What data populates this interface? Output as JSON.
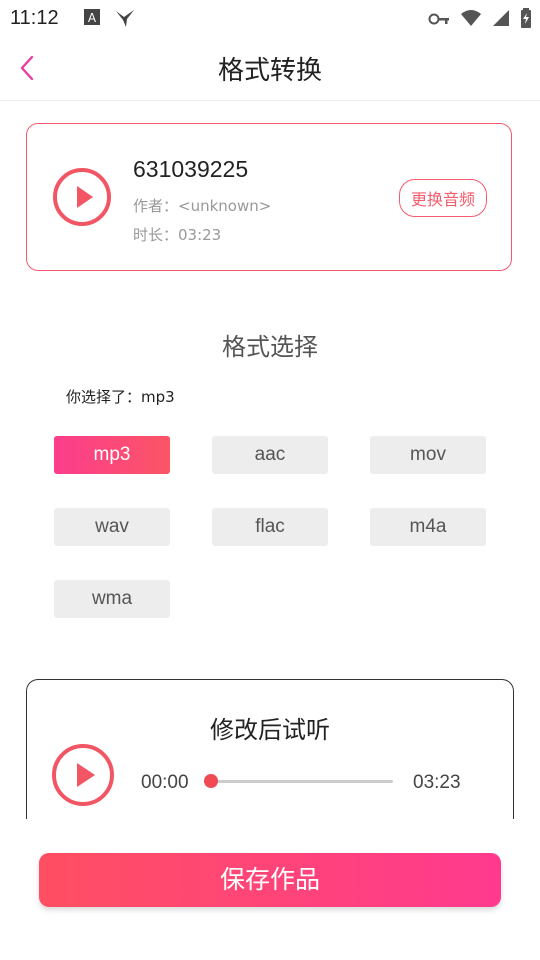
{
  "status_bar": {
    "time": "11:12"
  },
  "header": {
    "title": "格式转换"
  },
  "source_audio": {
    "title": "631039225",
    "author": "作者：<unknown>",
    "duration": "时长：03:23",
    "change_label": "更换音频"
  },
  "format_section": {
    "title": "格式选择",
    "selected_text": "你选择了：mp3",
    "options": [
      "mp3",
      "aac",
      "mov",
      "wav",
      "flac",
      "m4a",
      "wma"
    ],
    "selected_value": "mp3"
  },
  "preview": {
    "title": "修改后试听",
    "current_time": "00:00",
    "total_time": "03:23",
    "progress": 0
  },
  "footer": {
    "save_label": "保存作品"
  },
  "colors": {
    "accent": "#f45c6d",
    "active_start": "#fb3d8c",
    "active_end": "#fb5566"
  }
}
